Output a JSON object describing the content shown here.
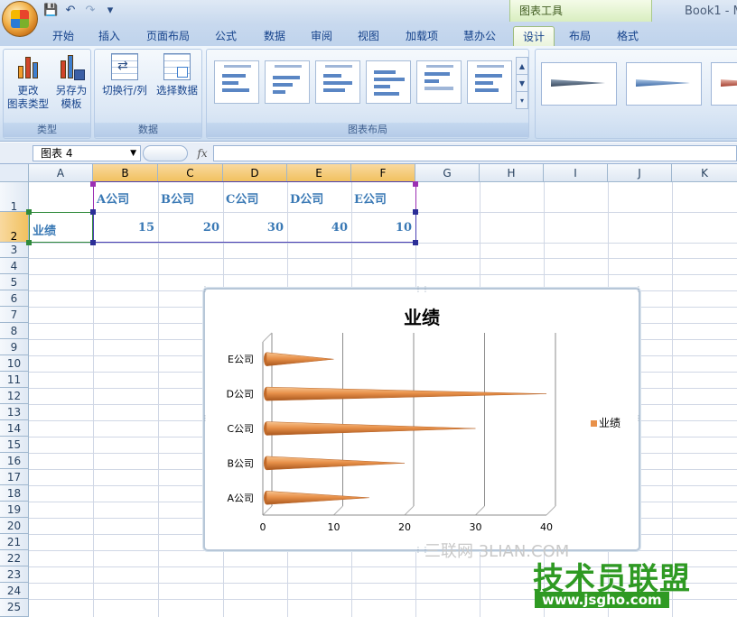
{
  "title_bar": {
    "context_label": "图表工具",
    "document_title": "Book1 - M"
  },
  "tabs": [
    {
      "label": "开始"
    },
    {
      "label": "插入"
    },
    {
      "label": "页面布局"
    },
    {
      "label": "公式"
    },
    {
      "label": "数据"
    },
    {
      "label": "审阅"
    },
    {
      "label": "视图"
    },
    {
      "label": "加载项"
    },
    {
      "label": "慧办公"
    },
    {
      "label": "设计",
      "active": true
    },
    {
      "label": "布局"
    },
    {
      "label": "格式"
    }
  ],
  "ribbon": {
    "type_group": {
      "label": "类型",
      "change_type_line1": "更改",
      "change_type_line2": "图表类型",
      "save_template_line1": "另存为",
      "save_template_line2": "模板"
    },
    "data_group": {
      "label": "数据",
      "switch_row_col": "切换行/列",
      "select_data": "选择数据"
    },
    "layouts_group": {
      "label": "图表布局"
    }
  },
  "formula_bar": {
    "name_box": "图表 4",
    "fx_label": "fx",
    "value": ""
  },
  "sheet": {
    "columns": [
      "A",
      "B",
      "C",
      "D",
      "E",
      "F",
      "G",
      "H",
      "I",
      "J",
      "K"
    ],
    "rows": [
      "1",
      "2",
      "3",
      "4",
      "5",
      "6",
      "7",
      "8",
      "9",
      "10",
      "11",
      "12",
      "13",
      "14",
      "15",
      "16",
      "17",
      "18",
      "19",
      "20",
      "21",
      "22",
      "23",
      "24",
      "25"
    ],
    "cells": {
      "A2": "业绩",
      "B1": "A公司",
      "C1": "B公司",
      "D1": "C公司",
      "E1": "D公司",
      "F1": "E公司",
      "B2": "15",
      "C2": "20",
      "D2": "30",
      "E2": "40",
      "F2": "10"
    }
  },
  "chart_data": {
    "type": "bar",
    "orientation": "horizontal",
    "style": "3d-cone",
    "title": "业绩",
    "categories": [
      "A公司",
      "B公司",
      "C公司",
      "D公司",
      "E公司"
    ],
    "series": [
      {
        "name": "业绩",
        "values": [
          15,
          20,
          30,
          40,
          10
        ],
        "color": "#e8914a"
      }
    ],
    "xlim": [
      0,
      40
    ],
    "x_ticks": [
      "0",
      "10",
      "20",
      "30",
      "40"
    ],
    "grid": true,
    "legend": "right"
  },
  "watermarks": {
    "site1": "三联网 3LIAN.COM",
    "site2": "技术员联盟",
    "site2_url": "www.jsgho.com"
  }
}
